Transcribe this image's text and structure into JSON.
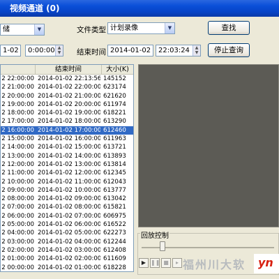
{
  "window": {
    "title": "视频通道 (0)"
  },
  "top_row": {
    "channel_value": "储",
    "file_type_label": "文件类型",
    "file_type_value": "计划录像",
    "search_button": "查找"
  },
  "time_row": {
    "start_date": "1-02",
    "start_time": "0:00:00",
    "end_time_label": "结束时间",
    "end_date": "2014-01-02",
    "end_time": "22:03:24",
    "stop_query_button": "停止查询"
  },
  "table": {
    "headers": {
      "start": "",
      "end": "结束时间",
      "size": "大小(K)"
    },
    "rows": [
      {
        "start": "2 22:00:00",
        "end": "2014-01-02 22:13:56",
        "size": "145152"
      },
      {
        "start": "2 21:00:00",
        "end": "2014-01-02 22:00:00",
        "size": "623174"
      },
      {
        "start": "2 20:00:00",
        "end": "2014-01-02 21:00:00",
        "size": "621620"
      },
      {
        "start": "2 19:00:00",
        "end": "2014-01-02 20:00:00",
        "size": "611974"
      },
      {
        "start": "2 18:00:00",
        "end": "2014-01-02 19:00:00",
        "size": "618221"
      },
      {
        "start": "2 17:00:00",
        "end": "2014-01-02 18:00:00",
        "size": "613290"
      },
      {
        "start": "2 16:00:00",
        "end": "2014-01-02 17:00:00",
        "size": "612460"
      },
      {
        "start": "2 15:00:00",
        "end": "2014-01-02 16:00:00",
        "size": "611963"
      },
      {
        "start": "2 14:00:00",
        "end": "2014-01-02 15:00:00",
        "size": "613721"
      },
      {
        "start": "2 13:00:00",
        "end": "2014-01-02 14:00:00",
        "size": "613893"
      },
      {
        "start": "2 12:00:00",
        "end": "2014-01-02 13:00:00",
        "size": "613814"
      },
      {
        "start": "2 11:00:00",
        "end": "2014-01-02 12:00:00",
        "size": "612345"
      },
      {
        "start": "2 10:00:00",
        "end": "2014-01-02 11:00:00",
        "size": "612043"
      },
      {
        "start": "2 09:00:00",
        "end": "2014-01-02 10:00:00",
        "size": "613777"
      },
      {
        "start": "2 08:00:00",
        "end": "2014-01-02 09:00:00",
        "size": "613042"
      },
      {
        "start": "2 07:00:00",
        "end": "2014-01-02 08:00:00",
        "size": "615821"
      },
      {
        "start": "2 06:00:00",
        "end": "2014-01-02 07:00:00",
        "size": "606975"
      },
      {
        "start": "2 05:00:00",
        "end": "2014-01-02 06:00:00",
        "size": "616522"
      },
      {
        "start": "2 04:00:00",
        "end": "2014-01-02 05:00:00",
        "size": "622273"
      },
      {
        "start": "2 03:00:00",
        "end": "2014-01-02 04:00:00",
        "size": "612244"
      },
      {
        "start": "2 02:00:00",
        "end": "2014-01-02 03:00:00",
        "size": "612408"
      },
      {
        "start": "2 01:00:00",
        "end": "2014-01-02 02:00:00",
        "size": "611609"
      },
      {
        "start": "2 00:00:00",
        "end": "2014-01-02 01:00:00",
        "size": "618228"
      }
    ],
    "selected_index": 6
  },
  "playback": {
    "label": "回放控制",
    "position": 0.16,
    "watermark": "福州川大软",
    "logo_text": "yn"
  },
  "colors": {
    "title_bar": "#0a4fd8",
    "selection": "#316ac5",
    "video_area": "#5c5b55",
    "logo_text": "#d82010"
  }
}
